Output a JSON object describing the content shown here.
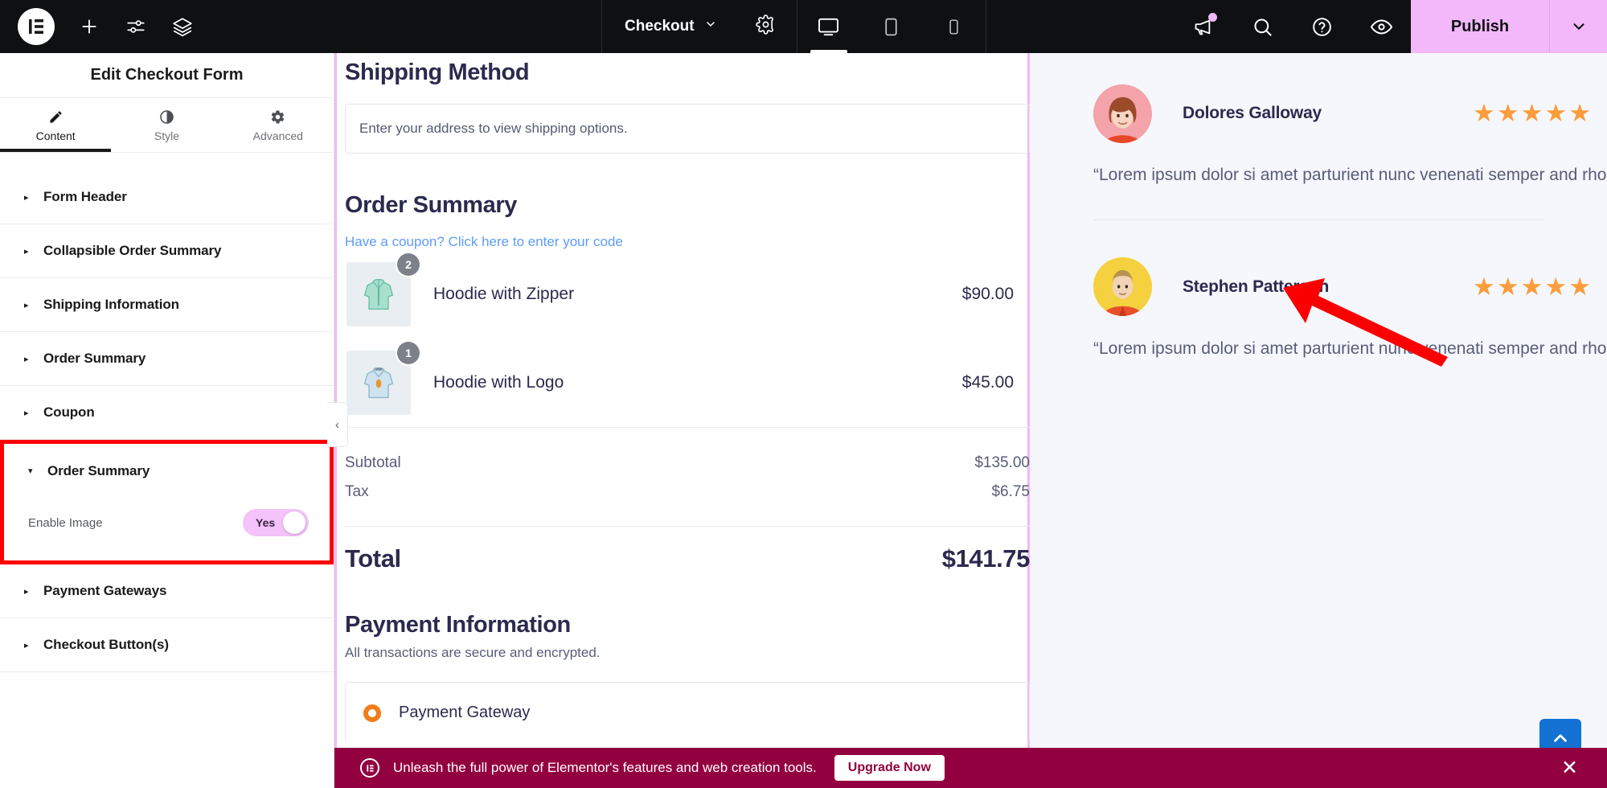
{
  "topbar": {
    "logo_icon": "elementor-logo-icon",
    "add_icon": "plus-icon",
    "settings_sliders_icon": "sliders-icon",
    "layers_icon": "layers-icon",
    "document_name": "Checkout",
    "document_caret_icon": "chevron-down-icon",
    "gear_icon": "gear-icon",
    "devices": [
      {
        "name": "desktop",
        "icon": "desktop-icon",
        "active": true
      },
      {
        "name": "tablet",
        "icon": "tablet-icon",
        "active": false
      },
      {
        "name": "mobile",
        "icon": "mobile-icon",
        "active": false
      }
    ],
    "megaphone_icon": "megaphone-icon",
    "search_icon": "search-icon",
    "help_icon": "help-circle-icon",
    "preview_icon": "eye-icon",
    "publish_label": "Publish",
    "publish_caret_icon": "chevron-down-icon",
    "publish_color": "#f2b8f9"
  },
  "sidebar": {
    "title": "Edit Checkout Form",
    "tabs": [
      {
        "label": "Content",
        "icon": "pencil-icon",
        "active": true
      },
      {
        "label": "Style",
        "icon": "contrast-circle-icon",
        "active": false
      },
      {
        "label": "Advanced",
        "icon": "gear-icon",
        "active": false
      }
    ],
    "sections": [
      {
        "label": "Form Header",
        "open": false
      },
      {
        "label": "Collapsible Order Summary",
        "open": false
      },
      {
        "label": "Shipping Information",
        "open": false
      },
      {
        "label": "Order Summary",
        "open": false
      },
      {
        "label": "Coupon",
        "open": false
      }
    ],
    "highlighted_section": {
      "label": "Order Summary",
      "open": true,
      "highlight_color": "#ff0000",
      "controls": [
        {
          "label": "Enable Image",
          "type": "toggle",
          "value": "Yes",
          "on": true
        }
      ]
    },
    "sections_after": [
      {
        "label": "Payment Gateways",
        "open": false
      },
      {
        "label": "Checkout Button(s)",
        "open": false
      }
    ],
    "collapse_handle_icon": "chevron-left-icon"
  },
  "canvas": {
    "shipping_method": {
      "heading": "Shipping Method",
      "placeholder": "Enter your address to view shipping options."
    },
    "order_summary": {
      "heading": "Order Summary",
      "coupon_link": "Have a coupon? Click here to enter your code",
      "items": [
        {
          "qty": "2",
          "name": "Hoodie with Zipper",
          "price": "$90.00",
          "image": "hoodie-zipper-thumb"
        },
        {
          "qty": "1",
          "name": "Hoodie with Logo",
          "price": "$45.00",
          "image": "hoodie-logo-thumb"
        }
      ],
      "totals": [
        {
          "label": "Subtotal",
          "value": "$135.00"
        },
        {
          "label": "Tax",
          "value": "$6.75"
        }
      ],
      "grand_total": {
        "label": "Total",
        "value": "$141.75"
      }
    },
    "payment": {
      "heading": "Payment Information",
      "subtext": "All transactions are secure and encrypted.",
      "gateway_label": "Payment Gateway",
      "gateway_radio_color": "#f07d1a"
    }
  },
  "testimonials": [
    {
      "name": "Dolores Galloway",
      "rating": "★★★★★",
      "quote": "“Lorem ipsum dolor si amet parturient nunc venenati semper and rhoncus nec. Sit rhoncus lore dolor.”",
      "avatar": "avatar-woman-red-hair"
    },
    {
      "name": "Stephen Patterson",
      "rating": "★★★★★",
      "quote": "“Lorem ipsum dolor si amet parturient nunc venenati semper and rhoncus nec. Sit rhoncus lore dolor.”",
      "avatar": "avatar-man-orange-shirt"
    }
  ],
  "scroll_top": {
    "icon": "chevron-up-icon",
    "color": "#1372d4"
  },
  "notice": {
    "icon": "elementor-badge-icon",
    "text": "Unleash the full power of Elementor's features and web creation tools.",
    "button_label": "Upgrade Now",
    "close_icon": "close-icon",
    "background": "#93003f"
  }
}
